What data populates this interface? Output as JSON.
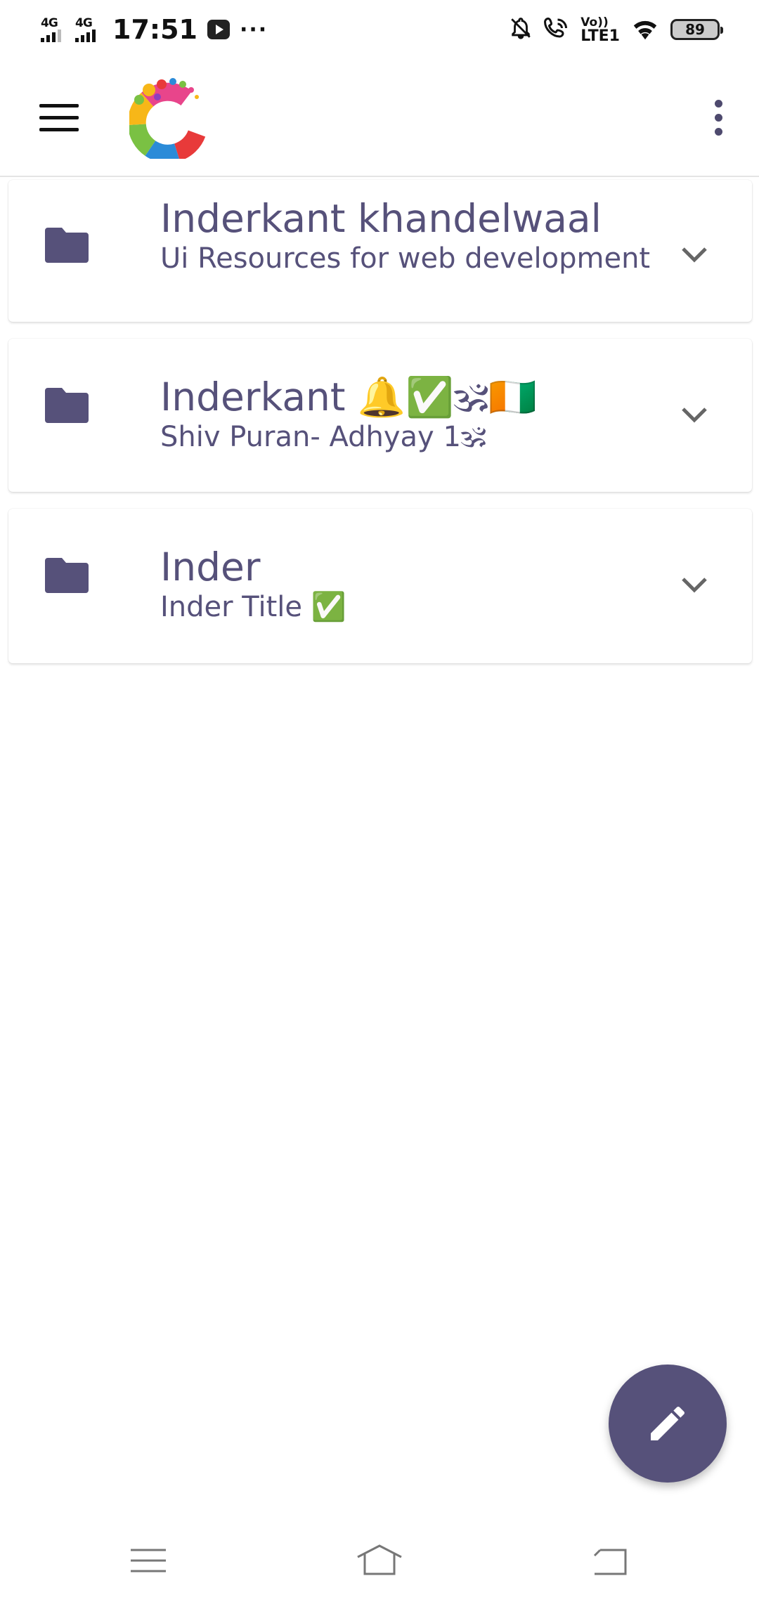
{
  "status_bar": {
    "network_1": "4G",
    "network_2": "4G",
    "time": "17:51",
    "more": "···",
    "volte_top": "Vo))",
    "volte_bottom": "LTE1",
    "battery": "89"
  },
  "app_bar": {
    "menu_icon": "hamburger-menu-icon",
    "logo": "colorful-c-logo",
    "more_icon": "vertical-dots-icon"
  },
  "notes": [
    {
      "title": "Inderkant khandelwaal",
      "subtitle": "Ui Resources for web development",
      "icon": "folder-icon"
    },
    {
      "title": "Inderkant 🔔✅🕉🇨🇮",
      "subtitle": "Shiv Puran- Adhyay 1🕉",
      "icon": "folder-icon"
    },
    {
      "title": "Inder",
      "subtitle": "Inder Title ✅",
      "icon": "folder-icon"
    }
  ],
  "fab": {
    "icon": "pencil-icon"
  },
  "nav_bar": {
    "recent": "recent-apps-icon",
    "home": "home-icon",
    "back": "back-icon"
  },
  "colors": {
    "primary": "#56517a",
    "text": "#56517a",
    "background": "#ffffff"
  }
}
